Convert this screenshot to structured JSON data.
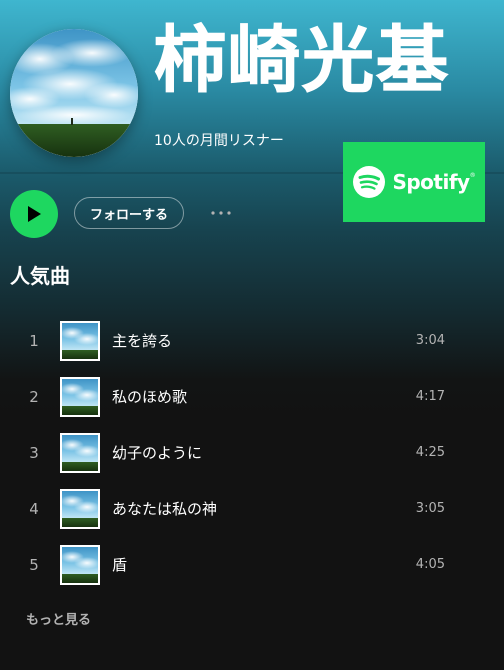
{
  "artist": {
    "name": "柿崎光基",
    "monthly_listeners": "10人の月間リスナー"
  },
  "brand": {
    "wordmark": "Spotify",
    "trademark": "®",
    "accent_color": "#1ed760"
  },
  "actions": {
    "play_icon": "play-icon",
    "follow_label": "フォローする",
    "more_icon": "ellipsis-icon"
  },
  "popular": {
    "heading": "人気曲",
    "tracks": [
      {
        "number": "1",
        "title": "主を誇る",
        "duration": "3:04"
      },
      {
        "number": "2",
        "title": "私のほめ歌",
        "duration": "4:17"
      },
      {
        "number": "3",
        "title": "幼子のように",
        "duration": "4:25"
      },
      {
        "number": "4",
        "title": "あなたは私の神",
        "duration": "3:05"
      },
      {
        "number": "5",
        "title": "盾",
        "duration": "4:05"
      }
    ],
    "see_more_label": "もっと見る"
  }
}
